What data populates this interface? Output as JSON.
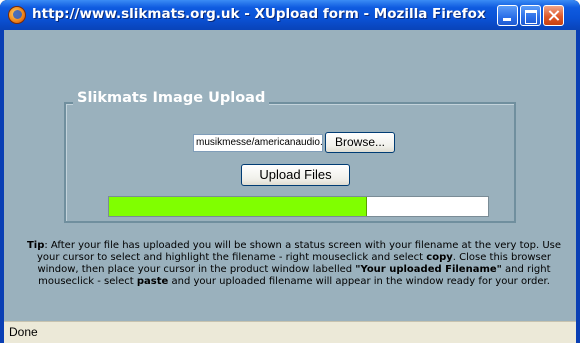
{
  "window": {
    "title": "http://www.slikmats.org.uk - XUpload form - Mozilla Firefox"
  },
  "form": {
    "legend": "Slikmats Image Upload",
    "file_value": "musikmesse/americanaudio.jpg",
    "browse_label": "Browse...",
    "upload_label": "Upload Files",
    "progress_fraction": 0.68
  },
  "tip": {
    "label": "Tip",
    "p1": ": After your file has uploaded you will be shown a status screen with your filename at the very top. Use your cursor to select and highlight the filename - right mouseclick and select ",
    "copy": "copy",
    "p2": ". Close this browser window, then place your cursor in the product window labelled ",
    "field_name": "\"Your uploaded Filename\"",
    "p3": " and right mouseclick - select ",
    "paste": "paste",
    "p4": " and your uploaded filename will appear in the window ready for your order."
  },
  "status": {
    "text": "Done"
  },
  "colors": {
    "progress_fill": "#80ff00",
    "content_bg": "#9ab1bd"
  },
  "icons": {
    "app": "firefox-icon",
    "minimize": "minimize-icon",
    "maximize": "maximize-icon",
    "close": "close-icon"
  }
}
